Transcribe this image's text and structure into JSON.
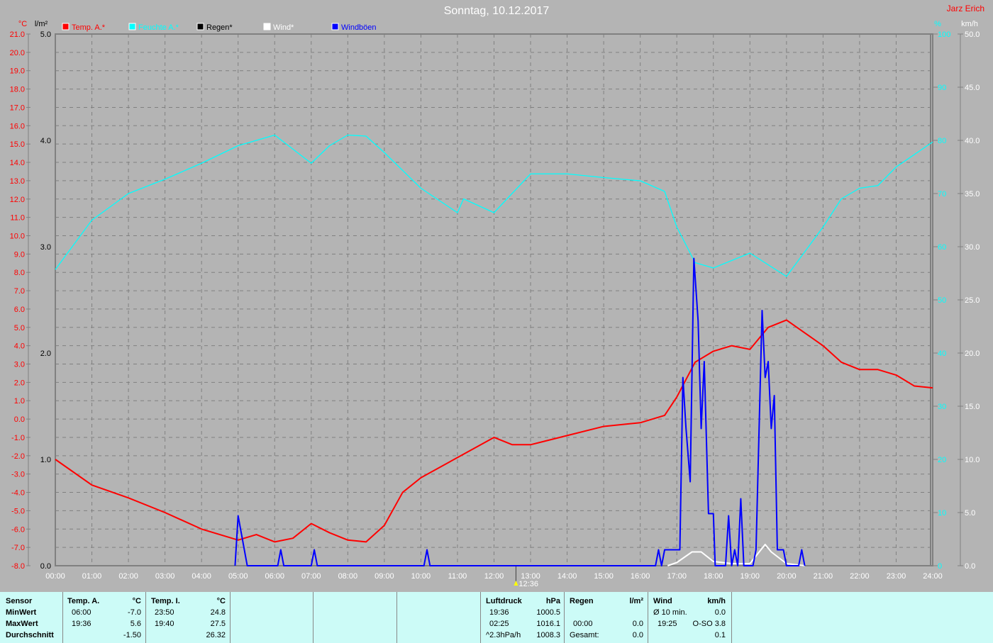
{
  "chart_data": {
    "type": "line",
    "title": "Sonntag, 10.12.2017",
    "author": "Jarz Erich",
    "colors": {
      "temp": "#ff0000",
      "humidity": "#00ffff",
      "rain": "#000000",
      "wind": "#ffffff",
      "gust": "#0000ff"
    },
    "legend": [
      "Temp. A.*",
      "Feuchte A.*",
      "Regen*",
      "Wind*",
      "Windböen"
    ],
    "axes": {
      "temp": {
        "unit": "°C",
        "range": [
          -8,
          21
        ],
        "ticks": [
          "21.0",
          "20.0",
          "19.0",
          "18.0",
          "17.0",
          "16.0",
          "15.0",
          "14.0",
          "13.0",
          "12.0",
          "11.0",
          "10.0",
          "9.0",
          "8.0",
          "7.0",
          "6.0",
          "5.0",
          "4.0",
          "3.0",
          "2.0",
          "1.0",
          "0.0",
          "-1.0",
          "-2.0",
          "-3.0",
          "-4.0",
          "-5.0",
          "-6.0",
          "-7.0",
          "-8.0"
        ]
      },
      "rain": {
        "unit": "l/m²",
        "range": [
          0,
          5
        ],
        "ticks": [
          "5.0",
          "4.0",
          "3.0",
          "2.0",
          "1.0",
          "0.0"
        ]
      },
      "humidity": {
        "unit": "%",
        "range": [
          0,
          100
        ],
        "ticks": [
          "100",
          "90",
          "80",
          "70",
          "60",
          "50",
          "40",
          "30",
          "20",
          "10",
          "0"
        ]
      },
      "wind": {
        "unit": "km/h",
        "range": [
          0,
          50
        ],
        "ticks": [
          "50.0",
          "45.0",
          "40.0",
          "35.0",
          "30.0",
          "25.0",
          "20.0",
          "15.0",
          "10.0",
          "5.0",
          "0.0"
        ]
      },
      "x_ticks": [
        "00:00",
        "01:00",
        "02:00",
        "03:00",
        "04:00",
        "05:00",
        "06:00",
        "07:00",
        "08:00",
        "09:00",
        "10:00",
        "11:00",
        "12:00",
        "13:00",
        "14:00",
        "15:00",
        "16:00",
        "17:00",
        "18:00",
        "19:00",
        "20:00",
        "21:00",
        "22:00",
        "23:00",
        "24:00"
      ]
    },
    "cursor": "12:36",
    "series": [
      {
        "name": "Temp. A.*",
        "axis": "temp",
        "points": [
          [
            0,
            -2.2
          ],
          [
            60,
            -3.6
          ],
          [
            120,
            -4.3
          ],
          [
            180,
            -5.1
          ],
          [
            240,
            -6.0
          ],
          [
            300,
            -6.6
          ],
          [
            330,
            -6.3
          ],
          [
            360,
            -6.7
          ],
          [
            390,
            -6.5
          ],
          [
            420,
            -5.7
          ],
          [
            450,
            -6.2
          ],
          [
            480,
            -6.6
          ],
          [
            510,
            -6.7
          ],
          [
            540,
            -5.8
          ],
          [
            570,
            -4.0
          ],
          [
            600,
            -3.2
          ],
          [
            660,
            -2.1
          ],
          [
            720,
            -1.0
          ],
          [
            750,
            -1.4
          ],
          [
            780,
            -1.4
          ],
          [
            840,
            -0.9
          ],
          [
            900,
            -0.4
          ],
          [
            960,
            -0.2
          ],
          [
            1000,
            0.2
          ],
          [
            1020,
            1.2
          ],
          [
            1050,
            3.1
          ],
          [
            1080,
            3.7
          ],
          [
            1110,
            4.0
          ],
          [
            1140,
            3.8
          ],
          [
            1170,
            5.0
          ],
          [
            1200,
            5.4
          ],
          [
            1230,
            4.7
          ],
          [
            1260,
            4.0
          ],
          [
            1290,
            3.1
          ],
          [
            1320,
            2.7
          ],
          [
            1350,
            2.7
          ],
          [
            1380,
            2.4
          ],
          [
            1410,
            1.8
          ],
          [
            1440,
            1.7
          ]
        ]
      },
      {
        "name": "Feuchte A.*",
        "axis": "humidity",
        "points": [
          [
            0,
            55.7
          ],
          [
            60,
            65
          ],
          [
            120,
            70
          ],
          [
            180,
            72.7
          ],
          [
            240,
            75.7
          ],
          [
            300,
            79
          ],
          [
            360,
            81
          ],
          [
            420,
            75.7
          ],
          [
            450,
            79
          ],
          [
            480,
            81
          ],
          [
            510,
            80.8
          ],
          [
            540,
            77.7
          ],
          [
            600,
            71
          ],
          [
            660,
            66.4
          ],
          [
            670,
            69
          ],
          [
            720,
            66.4
          ],
          [
            780,
            73.7
          ],
          [
            840,
            73.7
          ],
          [
            900,
            73
          ],
          [
            960,
            72.4
          ],
          [
            1000,
            70.4
          ],
          [
            1020,
            63.7
          ],
          [
            1050,
            57
          ],
          [
            1080,
            56
          ],
          [
            1140,
            58.8
          ],
          [
            1200,
            54.4
          ],
          [
            1260,
            63.7
          ],
          [
            1290,
            69
          ],
          [
            1320,
            71
          ],
          [
            1350,
            71.5
          ],
          [
            1380,
            75
          ],
          [
            1440,
            79.7
          ]
        ]
      },
      {
        "name": "Wind*",
        "axis": "wind",
        "points": [
          [
            1005,
            0
          ],
          [
            1020,
            0.3
          ],
          [
            1045,
            1.3
          ],
          [
            1060,
            1.3
          ],
          [
            1080,
            0.4
          ],
          [
            1110,
            0.2
          ],
          [
            1140,
            0.2
          ],
          [
            1165,
            2.0
          ],
          [
            1175,
            1.3
          ],
          [
            1200,
            0.2
          ],
          [
            1230,
            0
          ]
        ]
      },
      {
        "name": "Windböen",
        "axis": "wind",
        "points": [
          [
            295,
            0
          ],
          [
            300,
            4.7
          ],
          [
            315,
            0
          ],
          [
            365,
            0
          ],
          [
            370,
            1.5
          ],
          [
            375,
            0
          ],
          [
            420,
            0
          ],
          [
            425,
            1.5
          ],
          [
            430,
            0
          ],
          [
            605,
            0
          ],
          [
            610,
            1.5
          ],
          [
            615,
            0
          ],
          [
            985,
            0
          ],
          [
            990,
            1.5
          ],
          [
            995,
            0
          ],
          [
            1000,
            1.5
          ],
          [
            1025,
            1.5
          ],
          [
            1030,
            17.7
          ],
          [
            1035,
            13
          ],
          [
            1042,
            7.9
          ],
          [
            1048,
            28.9
          ],
          [
            1055,
            23
          ],
          [
            1060,
            12.9
          ],
          [
            1065,
            19.2
          ],
          [
            1072,
            4.9
          ],
          [
            1080,
            4.9
          ],
          [
            1083,
            0
          ],
          [
            1100,
            0
          ],
          [
            1105,
            4.7
          ],
          [
            1110,
            0
          ],
          [
            1115,
            1.5
          ],
          [
            1120,
            0
          ],
          [
            1125,
            6.3
          ],
          [
            1130,
            0
          ],
          [
            1145,
            0
          ],
          [
            1150,
            1.5
          ],
          [
            1160,
            24
          ],
          [
            1165,
            17.7
          ],
          [
            1170,
            19.2
          ],
          [
            1175,
            12.9
          ],
          [
            1180,
            16
          ],
          [
            1185,
            1.5
          ],
          [
            1195,
            1.5
          ],
          [
            1200,
            0
          ],
          [
            1220,
            0
          ],
          [
            1225,
            1.5
          ],
          [
            1230,
            0
          ]
        ]
      }
    ]
  },
  "stats": {
    "sensor": {
      "title": "Sensor",
      "rows": [
        "MinWert",
        "MaxWert",
        "Durchschnitt"
      ]
    },
    "temp_a": {
      "title": "Temp. A.",
      "unit": "°C",
      "min_time": "06:00",
      "min": "-7.0",
      "max_time": "19:36",
      "max": "5.6",
      "avg": "-1.50"
    },
    "temp_i": {
      "title": "Temp. I.",
      "unit": "°C",
      "min_time": "23:50",
      "min": "24.8",
      "max_time": "19:40",
      "max": "27.5",
      "avg": "26.32"
    },
    "pressure": {
      "title": "Luftdruck",
      "unit": "hPa",
      "min_time": "19:36",
      "min": "1000.5",
      "max_time": "02:25",
      "max": "1016.1",
      "trend": "^2.3hPa/h",
      "avg": "1008.3"
    },
    "rain": {
      "title": "Regen",
      "unit": "l/m²",
      "time": "00:00",
      "max": "0.0",
      "total_label": "Gesamt:",
      "total": "0.0"
    },
    "wind": {
      "title": "Wind",
      "unit": "km/h",
      "avg_label": "Ø 10 min.",
      "avg": "0.0",
      "max_time": "19:25",
      "max": "O-SO 3.8",
      "mean": "0.1"
    }
  }
}
